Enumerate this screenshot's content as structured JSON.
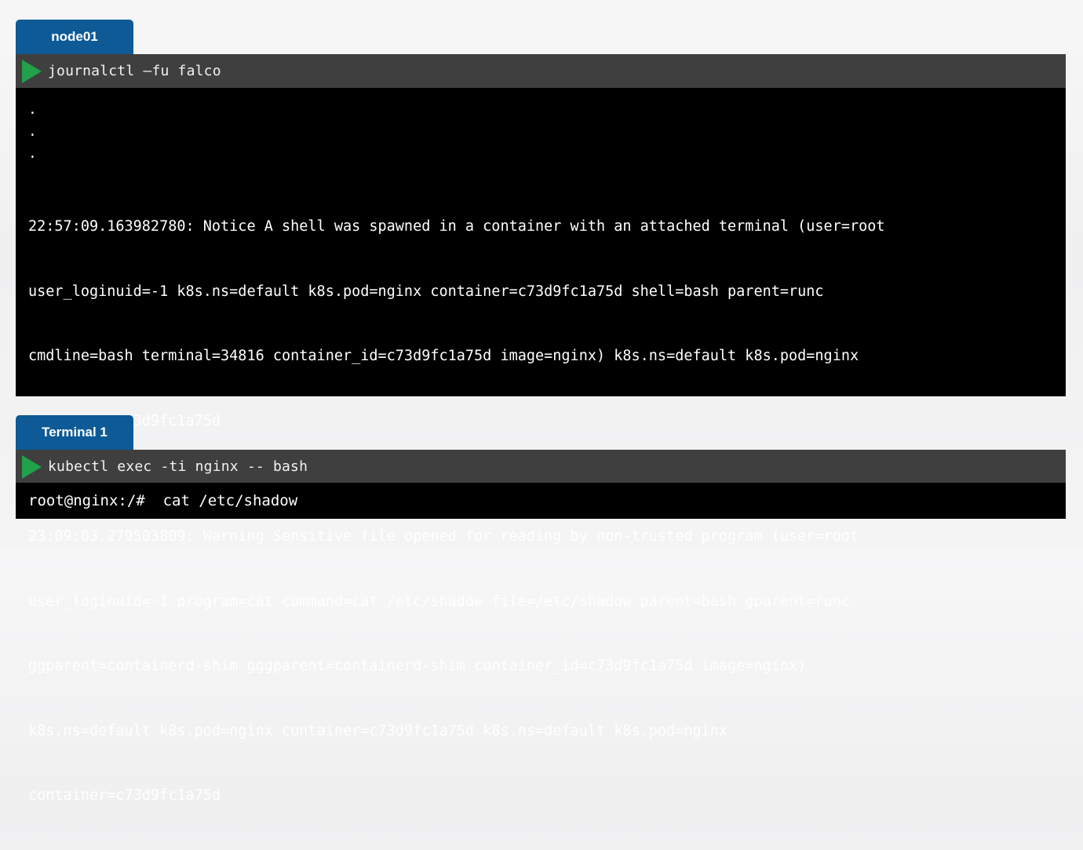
{
  "node01": {
    "tab_label": "node01",
    "command": "journalctl –fu falco",
    "output": {
      "ellipsis": [
        ".",
        ".",
        "."
      ],
      "entries": [
        {
          "lines": [
            "22:57:09.163982780: Notice A shell was spawned in a container with an attached terminal (user=root",
            "user_loginuid=-1 k8s.ns=default k8s.pod=nginx container=c73d9fc1a75d shell=bash parent=runc",
            "cmdline=bash terminal=34816 container_id=c73d9fc1a75d image=nginx) k8s.ns=default k8s.pod=nginx",
            "container=c73d9fc1a75d"
          ]
        },
        {
          "lines": [
            "23:09:03.279503809: Warning Sensitive file opened for reading by non-trusted program (user=root",
            "user_loginuid=-1 program=cat command=cat /etc/shadow file=/etc/shadow parent=bash gparent=runc",
            "ggparent=containerd-shim gggparent=containerd-shim container_id=c73d9fc1a75d image=nginx)",
            "k8s.ns=default k8s.pod=nginx container=c73d9fc1a75d k8s.ns=default k8s.pod=nginx",
            "container=c73d9fc1a75d"
          ]
        }
      ]
    }
  },
  "terminal1": {
    "tab_label": "Terminal 1",
    "command": "kubectl exec -ti nginx -- bash",
    "prompt_line": "root@nginx:/#  cat /etc/shadow"
  },
  "icons": {
    "run": "play-icon"
  },
  "colors": {
    "tab_background": "#0d5a96",
    "command_bar": "#3f3f3f",
    "terminal_background": "#000000",
    "play_icon": "#21a14b"
  }
}
